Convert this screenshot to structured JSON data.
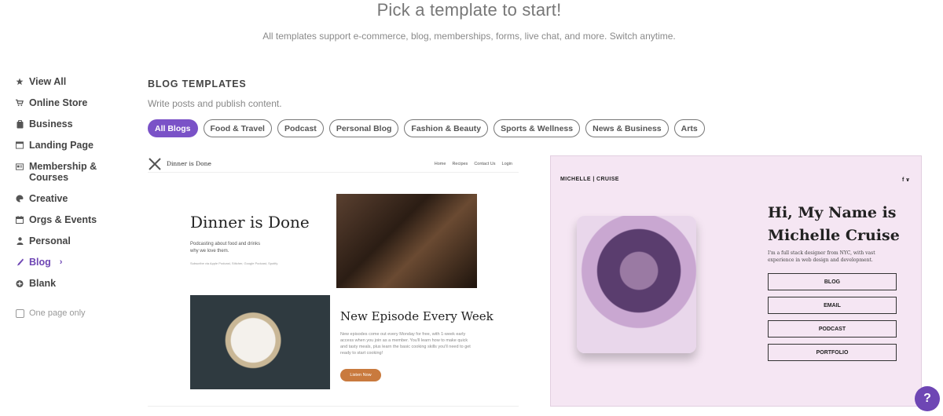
{
  "header": {
    "title": "Pick a template to start!",
    "subtitle": "All templates support e-commerce, blog, memberships, forms, live chat, and more. Switch anytime."
  },
  "sidebar": {
    "items": [
      {
        "label": "View All",
        "icon": "star-icon"
      },
      {
        "label": "Online Store",
        "icon": "cart-icon"
      },
      {
        "label": "Business",
        "icon": "briefcase-icon"
      },
      {
        "label": "Landing Page",
        "icon": "browser-icon"
      },
      {
        "label": "Membership & Courses",
        "icon": "id-card-icon"
      },
      {
        "label": "Creative",
        "icon": "palette-icon"
      },
      {
        "label": "Orgs & Events",
        "icon": "calendar-icon"
      },
      {
        "label": "Personal",
        "icon": "person-icon"
      },
      {
        "label": "Blog",
        "icon": "pen-icon",
        "active": true
      },
      {
        "label": "Blank",
        "icon": "plus-circle-icon"
      }
    ],
    "one_page_label": "One page only"
  },
  "section": {
    "heading": "BLOG TEMPLATES",
    "description": "Write posts and publish content."
  },
  "filters": [
    {
      "label": "All Blogs",
      "active": true
    },
    {
      "label": "Food & Travel"
    },
    {
      "label": "Podcast"
    },
    {
      "label": "Personal Blog"
    },
    {
      "label": "Fashion & Beauty"
    },
    {
      "label": "Sports & Wellness"
    },
    {
      "label": "News & Business"
    },
    {
      "label": "Arts"
    }
  ],
  "templates": {
    "dinner": {
      "logo_text": "Dinner is Done",
      "nav": [
        "Home",
        "Recipes",
        "Contact Us",
        "Login"
      ],
      "hero_title": "Dinner is Done",
      "tagline": "Podcasting about food and drinks why we love them.",
      "subscribe_text": "Subscribe via Apple Podcast, Stitcher, Google Podcast, Spotify",
      "episode_title": "New Episode Every Week",
      "episode_text": "New episodes come out every Monday for free, with 1-week early access when you join as a member. You'll learn how to make quick and tasty meals, plus learn the basic cooking skills you'll need to get ready to start cooking!",
      "cta": "Listen Now"
    },
    "michelle": {
      "brand": "MICHELLE | CRUISE",
      "social": "f ∨",
      "heading_line1": "Hi, My Name is",
      "heading_line2": "Michelle Cruise",
      "bio": "I'm a full stack designer from NYC, with vast experience in web design and development.",
      "buttons": [
        "BLOG",
        "EMAIL",
        "PODCAST",
        "PORTFOLIO"
      ]
    }
  },
  "help": {
    "label": "?"
  },
  "colors": {
    "accent": "#7a52c7",
    "card2_bg": "#f5e6f3"
  }
}
